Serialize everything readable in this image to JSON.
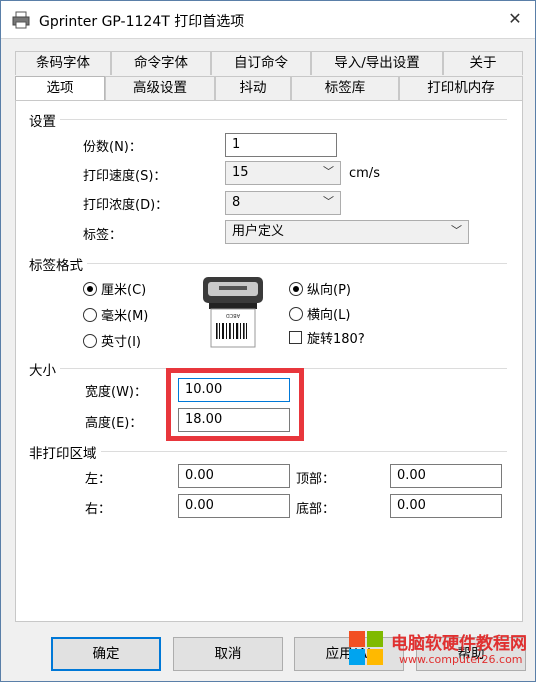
{
  "window": {
    "title": "Gprinter GP-1124T 打印首选项"
  },
  "tabs": {
    "row1": [
      "条码字体",
      "命令字体",
      "自订命令",
      "导入/导出设置",
      "关于"
    ],
    "row2": [
      "选项",
      "高级设置",
      "抖动",
      "标签库",
      "打印机内存"
    ],
    "active": "选项"
  },
  "settings": {
    "group_title": "设置",
    "copies_label": "份数(N)：",
    "copies_value": "1",
    "speed_label": "打印速度(S)：",
    "speed_value": "15",
    "speed_unit": "cm/s",
    "density_label": "打印浓度(D)：",
    "density_value": "8",
    "label_label": "标签：",
    "label_value": "用户定义"
  },
  "label_format": {
    "group_title": "标签格式",
    "unit_cm": "厘米(C)",
    "unit_mm": "毫米(M)",
    "unit_inch": "英寸(I)",
    "portrait": "纵向(P)",
    "landscape": "横向(L)",
    "rotate": "旋转180?",
    "label_sample": "ABCD",
    "selected_unit": "cm",
    "selected_orientation": "portrait",
    "rotate_checked": false
  },
  "size": {
    "group_title": "大小",
    "width_label": "宽度(W)：",
    "width_value": "10.00",
    "height_label": "高度(E)：",
    "height_value": "18.00"
  },
  "nonprint": {
    "group_title": "非打印区域",
    "left_label": "左：",
    "left_value": "0.00",
    "top_label": "顶部：",
    "top_value": "0.00",
    "right_label": "右：",
    "right_value": "0.00",
    "bottom_label": "底部：",
    "bottom_value": "0.00"
  },
  "buttons": {
    "ok": "确定",
    "cancel": "取消",
    "apply": "应用(A)",
    "help": "帮助"
  },
  "watermark": {
    "text": "电脑软硬件教程网",
    "url": "www.computer26.com"
  },
  "colors": {
    "highlight": "#e8363c",
    "focus": "#0078d7"
  }
}
